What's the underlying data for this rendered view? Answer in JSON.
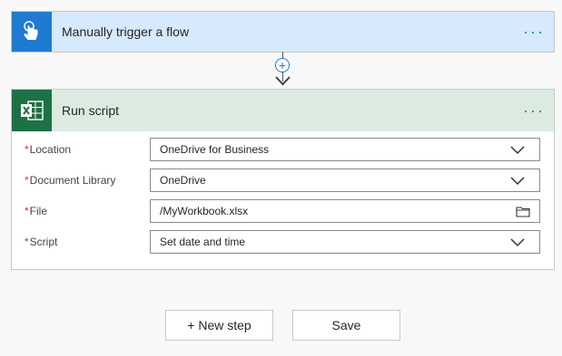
{
  "trigger": {
    "title": "Manually trigger a flow",
    "menu": "···"
  },
  "connector": {
    "plus": "+"
  },
  "action": {
    "title": "Run script",
    "menu": "···",
    "fields": [
      {
        "label": "Location",
        "required_mark": "*",
        "value": "OneDrive for Business",
        "kind": "dropdown"
      },
      {
        "label": "Document Library",
        "required_mark": "*",
        "value": "OneDrive",
        "kind": "dropdown"
      },
      {
        "label": "File",
        "required_mark": "*",
        "value": "/MyWorkbook.xlsx",
        "kind": "file-picker"
      },
      {
        "label": "Script",
        "required_mark": "*",
        "value": "Set date and time",
        "kind": "dropdown"
      }
    ]
  },
  "footer": {
    "new_step": "+ New step",
    "save": "Save"
  },
  "colors": {
    "accent": "#1f7ad1",
    "excel": "#1e7145",
    "required": "#d13438"
  }
}
